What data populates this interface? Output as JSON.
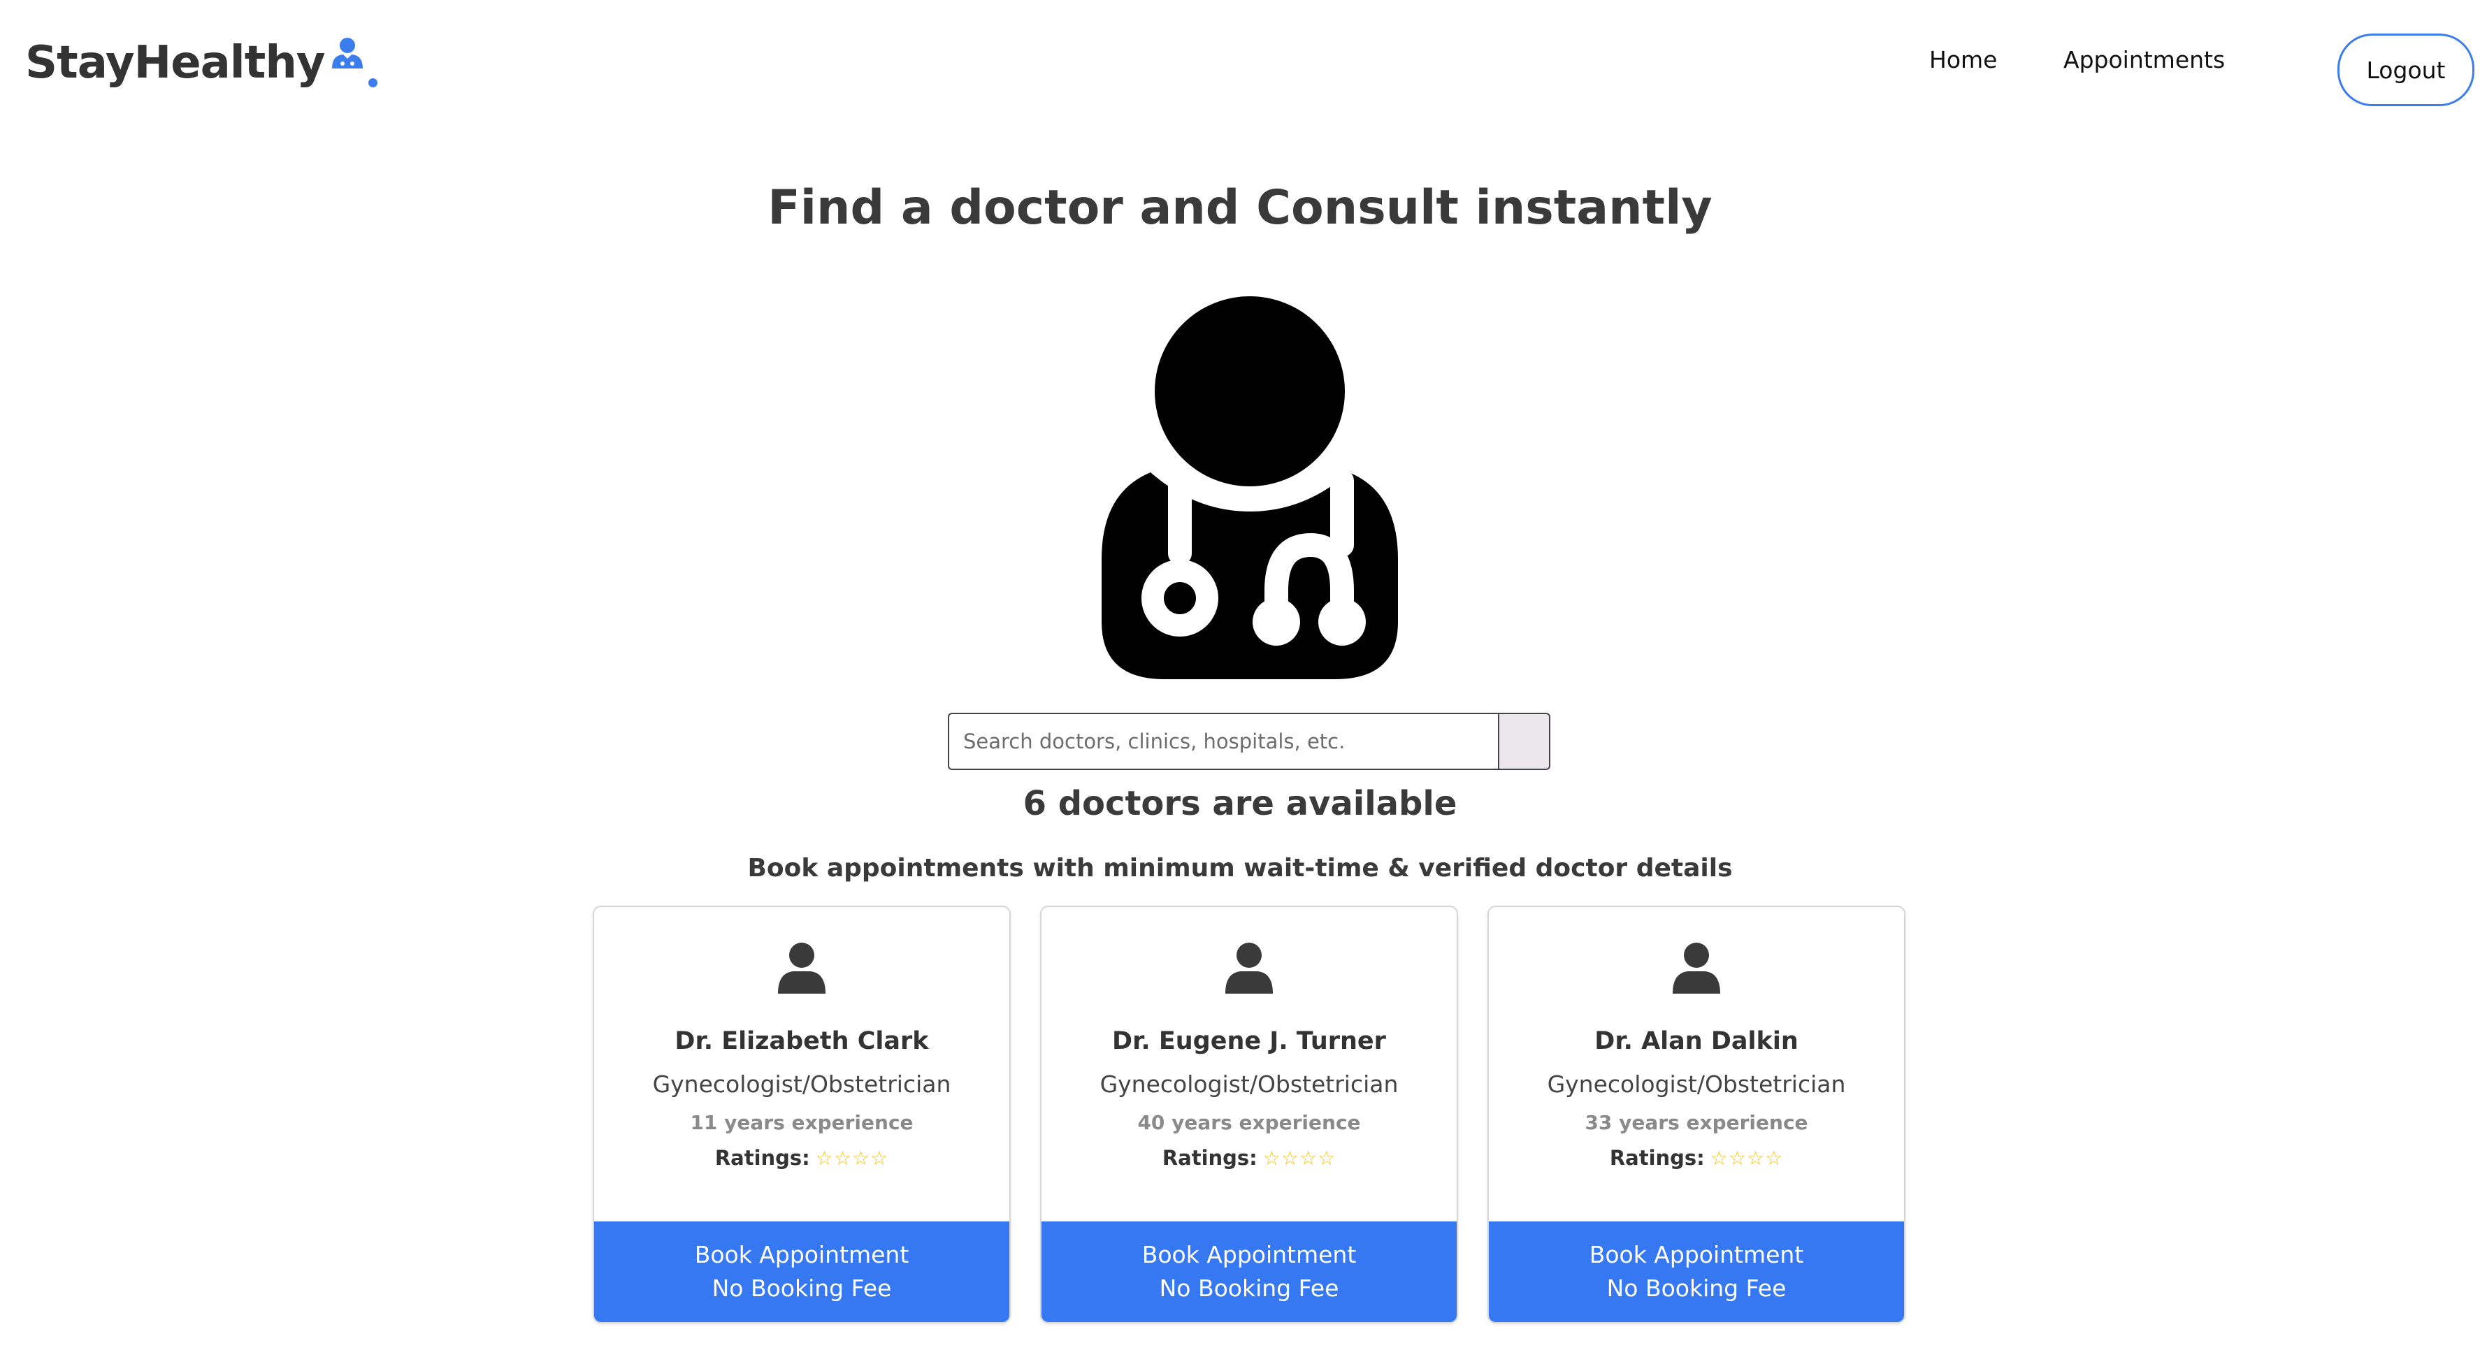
{
  "brand": {
    "name": "StayHealthy",
    "accent_color": "#3b7ded",
    "logo_icon": "doctor-icon"
  },
  "nav": {
    "links": [
      {
        "label": "Home"
      },
      {
        "label": "Appointments"
      }
    ],
    "logout_label": "Logout"
  },
  "hero": {
    "title": "Find a doctor and Consult instantly",
    "illustration_icon": "doctor-stethoscope-icon"
  },
  "search": {
    "placeholder": "Search doctors, clinics, hospitals, etc.",
    "value": "",
    "button_icon": "search-icon"
  },
  "results": {
    "available_text": "6 doctors are available",
    "subheading": "Book appointments with minimum wait-time & verified doctor details"
  },
  "doctors": [
    {
      "name": "Dr. Elizabeth Clark",
      "specialty": "Gynecologist/Obstetrician",
      "experience": "11 years experience",
      "ratings_label": "Ratings:",
      "stars": "☆☆☆☆",
      "button_line1": "Book Appointment",
      "button_line2": "No Booking Fee"
    },
    {
      "name": "Dr. Eugene J. Turner",
      "specialty": "Gynecologist/Obstetrician",
      "experience": "40 years experience",
      "ratings_label": "Ratings:",
      "stars": "☆☆☆☆",
      "button_line1": "Book Appointment",
      "button_line2": "No Booking Fee"
    },
    {
      "name": "Dr. Alan Dalkin",
      "specialty": "Gynecologist/Obstetrician",
      "experience": "33 years experience",
      "ratings_label": "Ratings:",
      "stars": "☆☆☆☆",
      "button_line1": "Book Appointment",
      "button_line2": "No Booking Fee"
    }
  ],
  "colors": {
    "button_blue": "#3678f2",
    "star_yellow": "#f5c518",
    "text_dark": "#3a3a3a"
  }
}
